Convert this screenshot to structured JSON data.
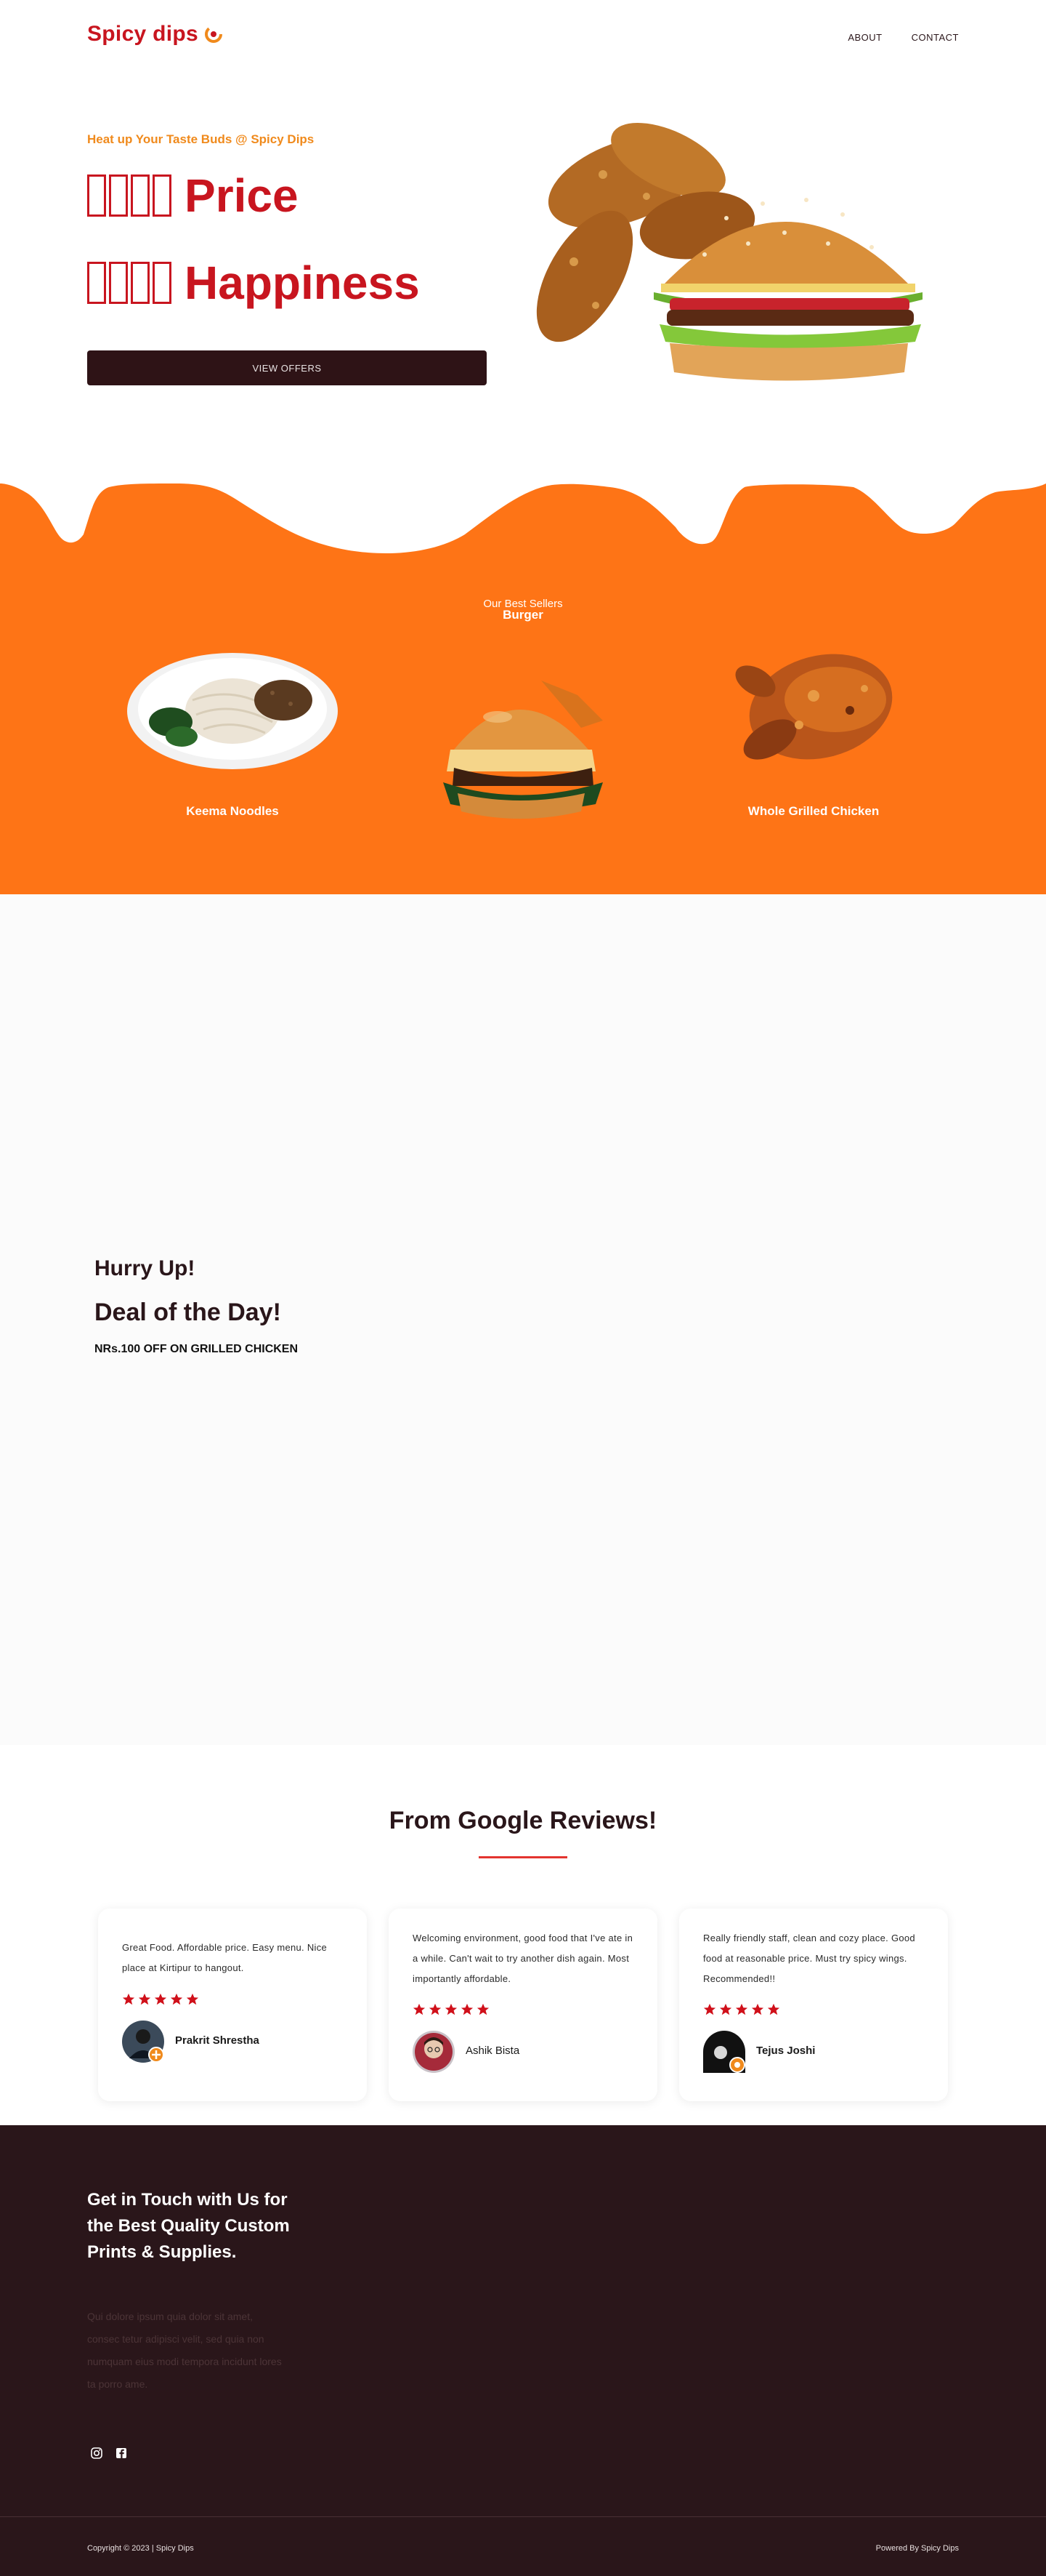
{
  "brand": {
    "name": "Spicy dips",
    "primary": "#c8151f",
    "accent_orange": "#fe7416",
    "dark": "#2a161a"
  },
  "nav": {
    "about": "ABOUT",
    "contact": "CONTACT"
  },
  "hero": {
    "tagline": "Heat up Your Taste Buds @ Spicy Dips",
    "line1_word": "Price",
    "line2_word": "Happiness",
    "button": "VIEW OFFERS"
  },
  "best_sellers": {
    "title": "Our Best Sellers",
    "featured": "Burger",
    "items": [
      {
        "name": "Keema Noodles"
      },
      {
        "name": ""
      },
      {
        "name": "Whole Grilled Chicken"
      }
    ]
  },
  "deal": {
    "hurry": "Hurry Up!",
    "title": "Deal of the Day!",
    "offer": "NRs.100 OFF ON GRILLED CHICKEN"
  },
  "reviews": {
    "title": "From Google Reviews!",
    "items": [
      {
        "text": "Great Food. Affordable price. Easy menu. Nice place at Kirtipur to hangout.",
        "stars": 5,
        "author": "Prakrit Shrestha"
      },
      {
        "text": "Welcoming environment, good food that I've ate in a while. Can't wait to try another dish again. Most importantly affordable.",
        "stars": 5,
        "author": "Ashik Bista"
      },
      {
        "text": "Really friendly staff, clean and cozy place. Good food at reasonable price. Must try spicy wings. Recommended!!",
        "stars": 5,
        "author": "Tejus Joshi"
      }
    ]
  },
  "footer": {
    "title": "Get in Touch with Us for the Best Quality Custom Prints & Supplies.",
    "body": "Qui dolore ipsum quia dolor sit amet, consec tetur adipisci velit, sed quia non numquam eius modi tempora incidunt lores ta porro ame.",
    "social": [
      "instagram-icon",
      "facebook-icon"
    ],
    "copyright": "Copyright © 2023 | Spicy Dips",
    "powered": "Powered By Spicy Dips"
  }
}
